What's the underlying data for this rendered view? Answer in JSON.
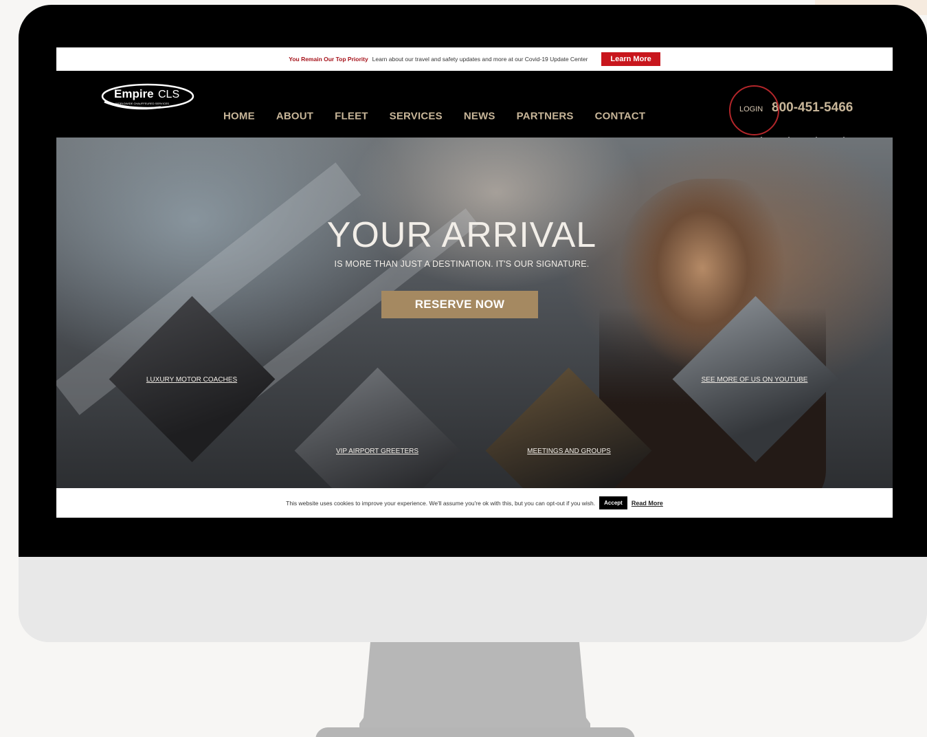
{
  "topbar": {
    "priority": "You Remain Our Top Priority",
    "message": "Learn about our travel and safety updates and more at our Covid-19 Update Center",
    "learn_more": "Learn More"
  },
  "brand": {
    "name_bold": "Empire",
    "name_light": "CLS",
    "tagline": "WORLDWIDE CHAUFFEURED SERVICES"
  },
  "nav": {
    "items": [
      "HOME",
      "ABOUT",
      "FLEET",
      "SERVICES",
      "NEWS",
      "PARTNERS",
      "CONTACT"
    ],
    "login": "LOGIN",
    "phone": "800-451-5466",
    "socials": [
      "instagram-icon",
      "linkedin-icon",
      "twitter-icon",
      "facebook-icon"
    ]
  },
  "hero": {
    "title": "YOUR ARRIVAL",
    "subtitle": "IS MORE THAN JUST A DESTINATION. IT'S OUR SIGNATURE.",
    "cta": "RESERVE NOW",
    "tiles": [
      {
        "label": "LUXURY MOTOR COACHES"
      },
      {
        "label": "VIP AIRPORT GREETERS"
      },
      {
        "label": "MEETINGS AND GROUPS"
      },
      {
        "label": "SEE MORE OF US ON YOUTUBE"
      }
    ]
  },
  "cookie": {
    "text": "This website uses cookies to improve your experience. We'll assume you're ok with this, but you can opt-out if you wish.",
    "accept": "Accept",
    "read_more": "Read More"
  },
  "colors": {
    "gold": "#c8b699",
    "reserve": "#a58961",
    "red": "#c8161d",
    "highlight_circle": "#b3262a"
  }
}
